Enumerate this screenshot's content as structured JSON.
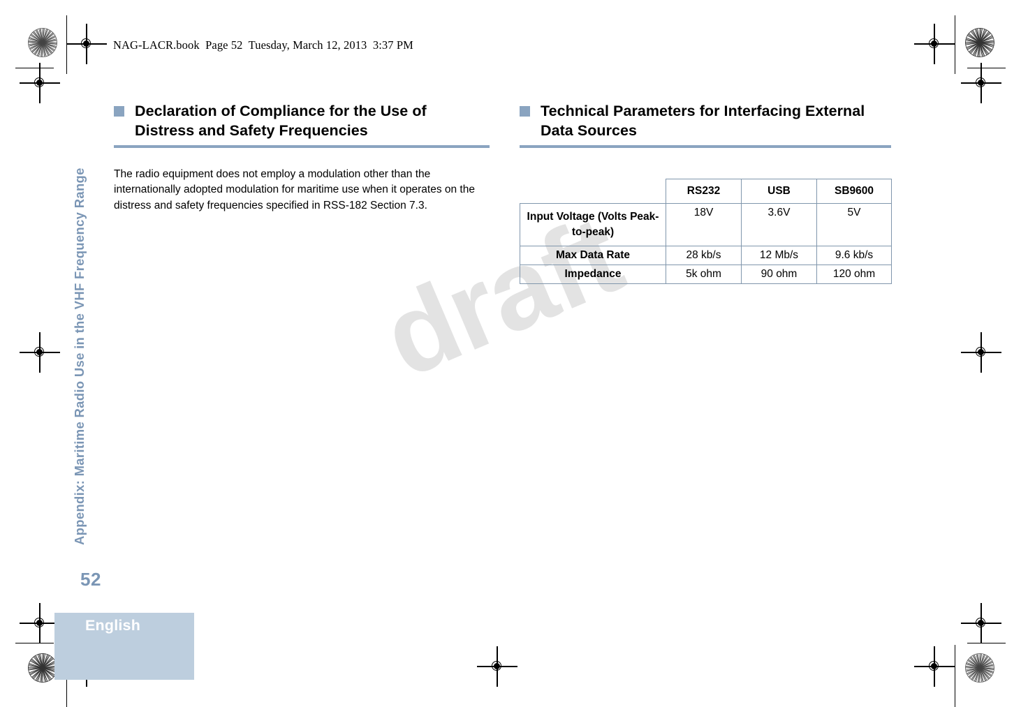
{
  "document": {
    "file_header": "NAG-LACR.book  Page 52  Tuesday, March 12, 2013  3:37 PM",
    "page_number": "52",
    "language_tab": "English",
    "running_title": "Appendix: Maritime Radio Use in the VHF Frequency Range",
    "watermark": "draft"
  },
  "colors": {
    "accent_blue": "#8aa4c0",
    "tab_blue": "#bdcede",
    "heading_blue": "#7b96b5",
    "table_border": "#8096ac",
    "watermark_gray": "#e3e3e3"
  },
  "left_column": {
    "heading": "Declaration of Compliance for the Use of Distress and Safety Frequencies",
    "paragraph": "The radio equipment does not employ a modulation other than the internationally adopted modulation for maritime use when it operates on the distress and safety frequencies specified in RSS-182 Section 7.3."
  },
  "right_column": {
    "heading": "Technical Parameters for Interfacing External Data Sources",
    "table": {
      "corner_label": "",
      "columns": [
        "RS232",
        "USB",
        "SB9600"
      ],
      "rows": [
        {
          "label": "Input Voltage (Volts Peak-to-peak)",
          "values": [
            "18V",
            "3.6V",
            "5V"
          ]
        },
        {
          "label": "Max Data Rate",
          "values": [
            "28 kb/s",
            "12 Mb/s",
            "9.6 kb/s"
          ]
        },
        {
          "label": "Impedance",
          "values": [
            "5k ohm",
            "90 ohm",
            "120 ohm"
          ]
        }
      ]
    }
  }
}
